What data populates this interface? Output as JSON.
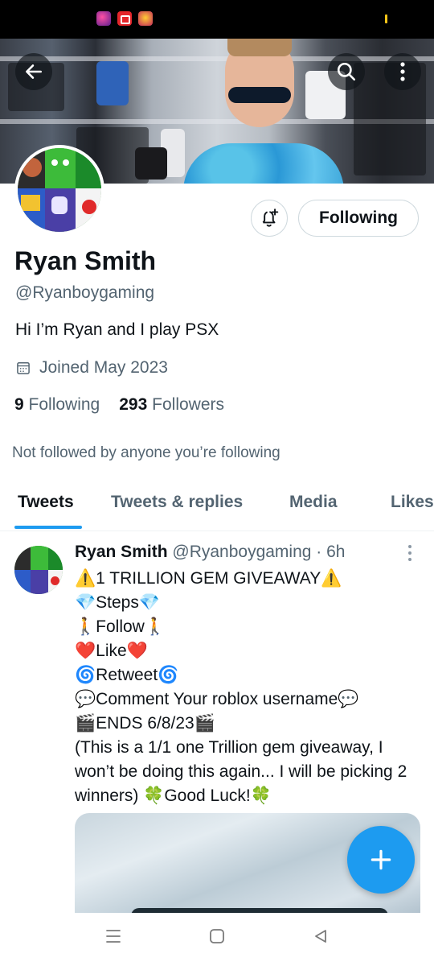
{
  "status_bar": {
    "app_icons": [
      "slots-app-icon",
      "screen-recorder-icon",
      "slots-game-icon"
    ],
    "accent": "#f5c518"
  },
  "header": {
    "back_icon": "arrow-left-icon",
    "search_icon": "search-icon",
    "more_icon": "more-vertical-icon"
  },
  "profile": {
    "name": "Ryan Smith",
    "handle": "@Ryanboygaming",
    "bio": "Hi I’m Ryan and I play PSX",
    "joined": "Joined May 2023",
    "following_count": "9",
    "following_label": "Following",
    "followers_count": "293",
    "followers_label": "Followers",
    "not_followed": "Not followed by anyone you’re following",
    "follow_button_label": "Following",
    "notify_icon": "bell-plus-icon"
  },
  "tabs": [
    {
      "label": "Tweets",
      "active": true
    },
    {
      "label": "Tweets & replies",
      "active": false
    },
    {
      "label": "Media",
      "active": false
    },
    {
      "label": "Likes",
      "active": false
    }
  ],
  "tweet": {
    "author": "Ryan Smith",
    "handle_time": "@Ryanboygaming · 6h",
    "lines": [
      "⚠️1 TRILLION GEM GIVEAWAY⚠️",
      "💎Steps💎",
      "🚶Follow🚶",
      "❤️Like❤️",
      "🌀Retweet🌀",
      "💬Comment Your roblox username💬",
      "🎬ENDS 6/8/23🎬",
      "(This is a 1/1 one Trillion gem giveaway, I won’t be doing this again... I will be picking 2 winners) 🍀Good Luck!🍀"
    ]
  },
  "fab": {
    "icon": "plus-icon",
    "color": "#1d9bf0"
  },
  "colors": {
    "accent": "#1d9bf0",
    "text_primary": "#0f1419",
    "text_secondary": "#536471"
  }
}
